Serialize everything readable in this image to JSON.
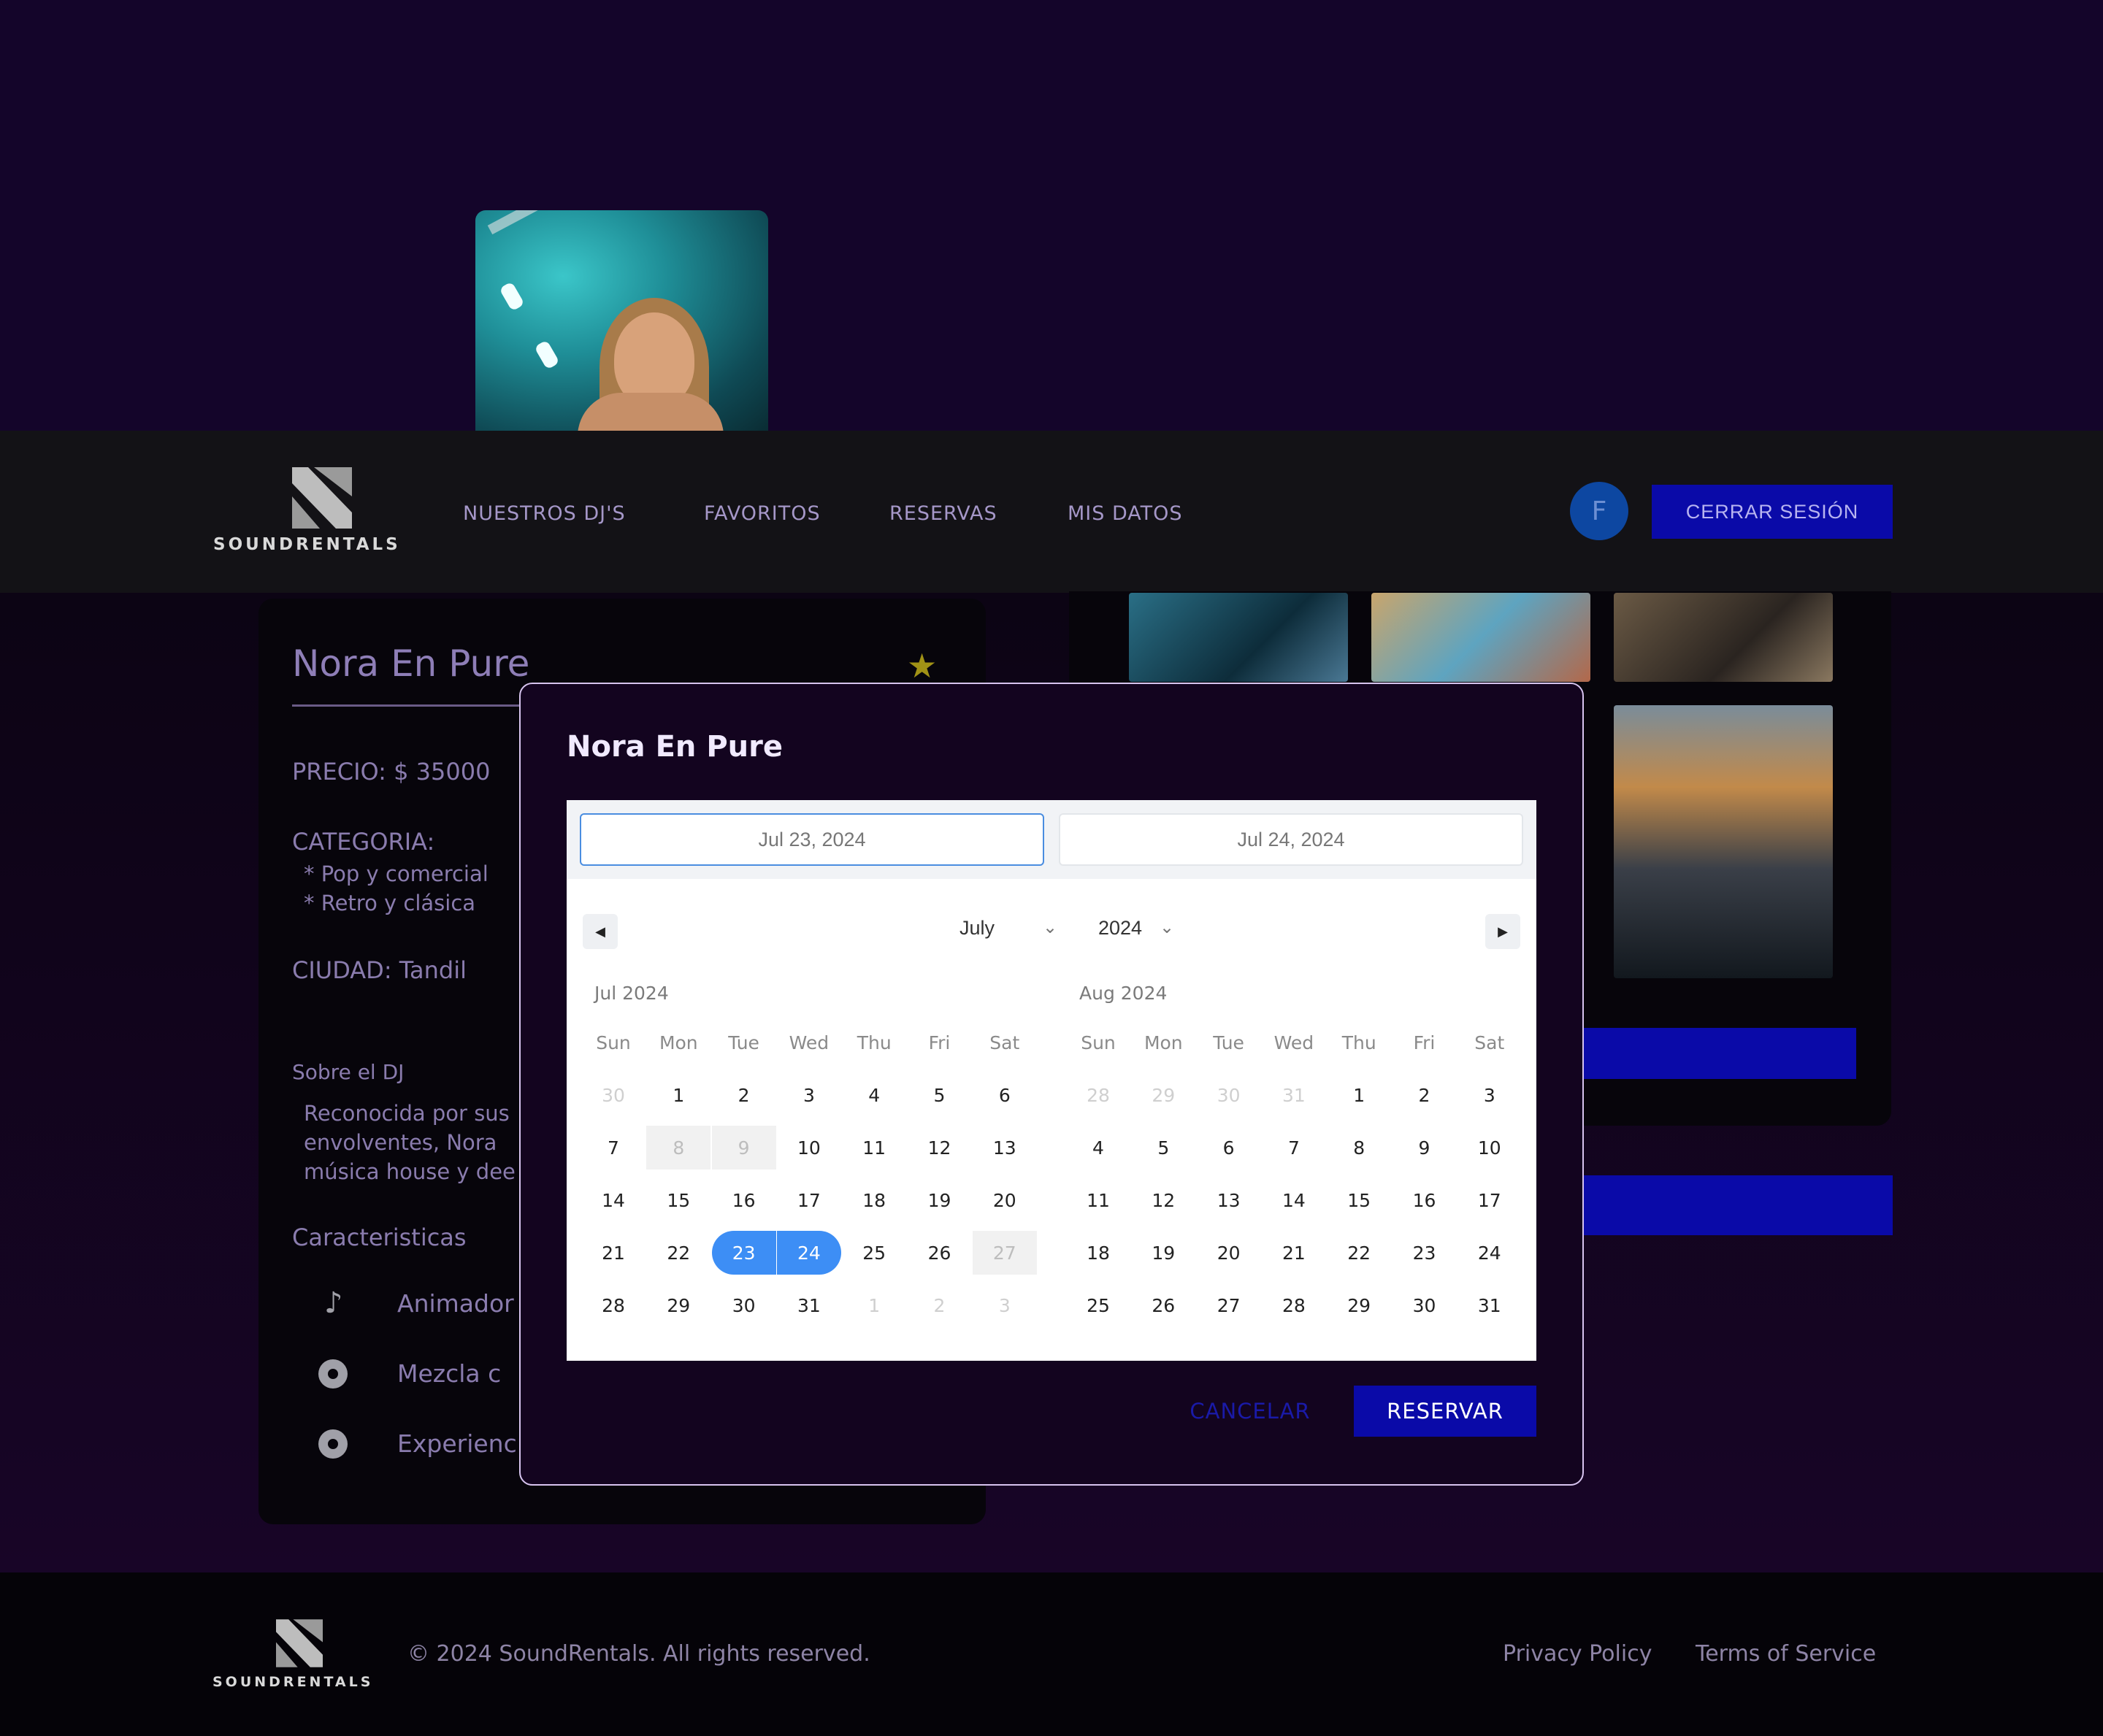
{
  "brand": {
    "name": "SOUNDRENTALS"
  },
  "nav": {
    "links": [
      "NUESTROS DJ'S",
      "FAVORITOS",
      "RESERVAS",
      "MIS DATOS"
    ],
    "avatar_initial": "F",
    "logout_label": "CERRAR SESIÓN"
  },
  "dj": {
    "name": "Nora En Pure",
    "price": "PRECIO: $ 35000",
    "category_label": "CATEGORIA:",
    "categories": [
      "* Pop y comercial",
      "* Retro y clásica"
    ],
    "city": "CIUDAD: Tandil",
    "about_label": "Sobre el DJ",
    "about_lines": [
      "Reconocida por sus",
      "envolventes, Nora",
      "música house y dee"
    ],
    "features_label": "Caracteristicas",
    "features": [
      "Animador",
      "Mezcla c",
      "Experienc"
    ]
  },
  "modal": {
    "title": "Nora En Pure",
    "start_date": "Jul 23, 2024",
    "end_date": "Jul 24, 2024",
    "month_select": "July",
    "year_select": "2024",
    "weekdays": [
      "Sun",
      "Mon",
      "Tue",
      "Wed",
      "Thu",
      "Fri",
      "Sat"
    ],
    "months": [
      {
        "label": "Jul 2024",
        "weeks": [
          [
            "30",
            "1",
            "2",
            "3",
            "4",
            "5",
            "6"
          ],
          [
            "7",
            "8",
            "9",
            "10",
            "11",
            "12",
            "13"
          ],
          [
            "14",
            "15",
            "16",
            "17",
            "18",
            "19",
            "20"
          ],
          [
            "21",
            "22",
            "23",
            "24",
            "25",
            "26",
            "27"
          ],
          [
            "28",
            "29",
            "30",
            "31",
            "1",
            "2",
            "3"
          ]
        ]
      },
      {
        "label": "Aug 2024",
        "weeks": [
          [
            "28",
            "29",
            "30",
            "31",
            "1",
            "2",
            "3"
          ],
          [
            "4",
            "5",
            "6",
            "7",
            "8",
            "9",
            "10"
          ],
          [
            "11",
            "12",
            "13",
            "14",
            "15",
            "16",
            "17"
          ],
          [
            "18",
            "19",
            "20",
            "21",
            "22",
            "23",
            "24"
          ],
          [
            "25",
            "26",
            "27",
            "28",
            "29",
            "30",
            "31"
          ]
        ]
      }
    ],
    "cancel_label": "CANCELAR",
    "reserve_label": "RESERVAR"
  },
  "footer": {
    "copyright": "© 2024 SoundRentals. All rights reserved.",
    "links": [
      "Privacy Policy",
      "Terms of Service"
    ]
  }
}
